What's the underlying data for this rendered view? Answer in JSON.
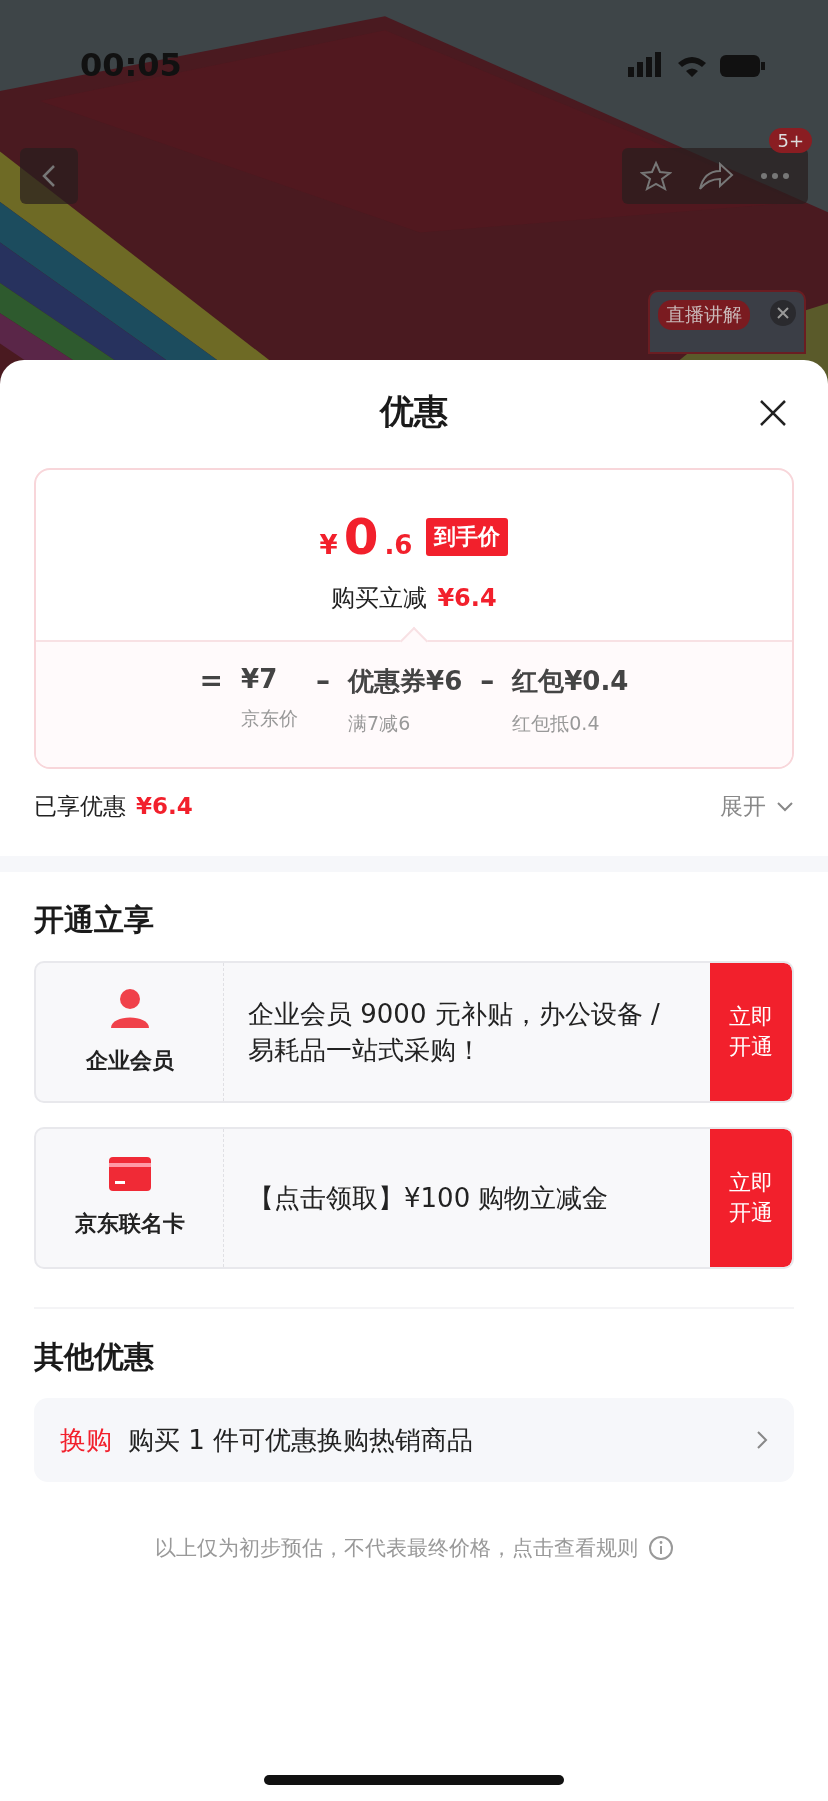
{
  "status_bar": {
    "time": "00:05"
  },
  "product_header": {
    "cart_badge": "5+",
    "live_badge": "直播讲解"
  },
  "sheet": {
    "title": "优惠",
    "price_card": {
      "currency": "¥",
      "integer": "0",
      "decimal": ".6",
      "tag": "到手价",
      "saving_label": "购买立减",
      "saving_value": "¥6.4",
      "breakdown": [
        {
          "op": "=",
          "value": "¥7",
          "note": "京东价"
        },
        {
          "op": "–",
          "value": "优惠券¥6",
          "note": "满7减6"
        },
        {
          "op": "–",
          "value": "红包¥0.4",
          "note": "红包抵0.4"
        }
      ]
    },
    "enjoyed": {
      "label": "已享优惠",
      "value": "¥6.4",
      "toggle": "展开",
      "expanded": false
    },
    "open_section": {
      "title": "开通立享",
      "offers": [
        {
          "kind": "person",
          "name": "企业会员",
          "text": "企业会员 9000 元补贴，办公设备 / 易耗品一站式采购！",
          "action": "立即开通"
        },
        {
          "kind": "card",
          "name": "京东联名卡",
          "text": "【点击领取】¥100 购物立减金",
          "action": "立即开通"
        }
      ]
    },
    "other_section": {
      "title": "其他优惠",
      "items": [
        {
          "tag": "换购",
          "text": "购买 1 件可优惠换购热销商品"
        }
      ]
    },
    "footnote": "以上仅为初步预估，不代表最终价格，点击查看规则"
  }
}
